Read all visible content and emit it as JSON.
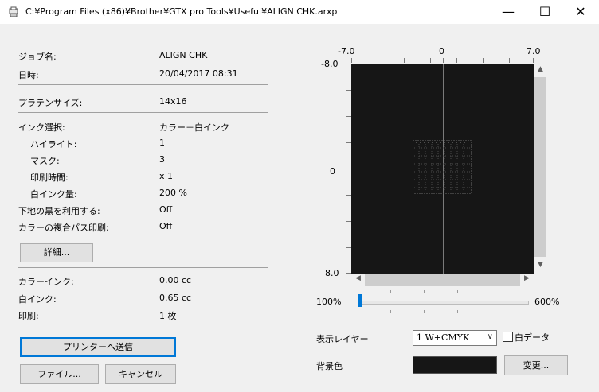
{
  "window": {
    "title": "C:¥Program Files (x86)¥Brother¥GTX pro Tools¥Useful¥ALIGN CHK.arxp",
    "minimize": "—",
    "maximize": "☐",
    "close": "✕"
  },
  "info": {
    "job_label": "ジョブ名:",
    "job_value": "ALIGN CHK",
    "date_label": "日時:",
    "date_value": "20/04/2017 08:31",
    "platen_label": "プラテンサイズ:",
    "platen_value": "14x16",
    "ink_label": "インク選択:",
    "ink_value": "カラー＋白インク",
    "highlight_label": "ハイライト:",
    "highlight_value": "1",
    "mask_label": "マスク:",
    "mask_value": "3",
    "print_time_label": "印刷時間:",
    "print_time_value": "x 1",
    "white_ink_label": "白インク量:",
    "white_ink_value": "200 %",
    "black_base_label": "下地の黒を利用する:",
    "black_base_value": "Off",
    "multipass_label": "カラーの複合パス印刷:",
    "multipass_value": "Off",
    "color_ink_label": "カラーインク:",
    "color_ink_value": "0.00 cc",
    "white_ink_cc_label": "白インク:",
    "white_ink_cc_value": "0.65 cc",
    "prints_label": "印刷:",
    "prints_value": "1 枚"
  },
  "buttons": {
    "details": "詳細...",
    "send": "プリンターへ送信",
    "file": "ファイル...",
    "cancel": "キャンセル",
    "change": "変更..."
  },
  "preview": {
    "x_ticks": [
      "-7.0",
      "0",
      "7.0"
    ],
    "y_ticks": [
      "-8.0",
      "0",
      "8.0"
    ],
    "zoom_min": "100%",
    "zoom_max": "600%",
    "zoom_value": 0
  },
  "layer": {
    "label": "表示レイヤー",
    "selected": "1 W+CMYK",
    "white_data_label": "白データ",
    "white_data_checked": false
  },
  "background": {
    "label": "背景色",
    "color": "#161616"
  }
}
